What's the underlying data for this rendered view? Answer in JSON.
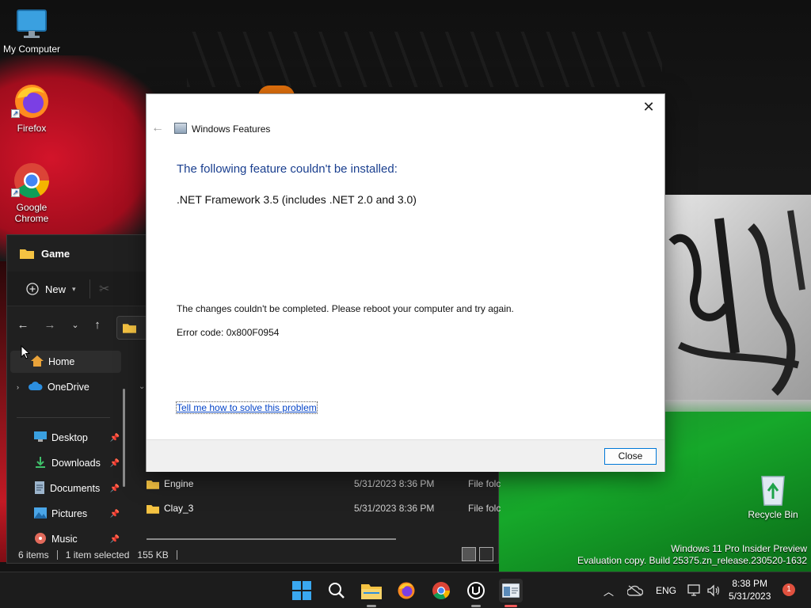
{
  "desktop": {
    "icons": [
      {
        "label": "My Computer"
      },
      {
        "label": "Firefox"
      },
      {
        "label": "Google Chrome"
      }
    ],
    "recycle_bin": "Recycle Bin",
    "watermark": {
      "line1": "Windows 11 Pro Insider Preview",
      "line2": "Evaluation copy. Build 25375.zn_release.230520-1632"
    }
  },
  "explorer": {
    "title": "Game",
    "toolbar": {
      "new_label": "New"
    },
    "sidebar": [
      {
        "label": "Home",
        "icon": "home-icon"
      },
      {
        "label": "OneDrive",
        "icon": "cloud-icon"
      },
      {
        "label": "Desktop",
        "icon": "desktop-icon"
      },
      {
        "label": "Downloads",
        "icon": "download-icon"
      },
      {
        "label": "Documents",
        "icon": "document-icon"
      },
      {
        "label": "Pictures",
        "icon": "picture-icon"
      },
      {
        "label": "Music",
        "icon": "music-icon"
      }
    ],
    "files": [
      {
        "name": "Engine",
        "date": "5/31/2023 8:36 PM",
        "type": "File folc"
      },
      {
        "name": "Clay_3",
        "date": "5/31/2023 8:36 PM",
        "type": "File folc"
      }
    ],
    "status": {
      "items": "6 items",
      "selected": "1 item selected",
      "size": "155 KB"
    }
  },
  "dialog": {
    "window_title": "Windows Features",
    "heading": "The following feature couldn't be installed:",
    "feature": ".NET Framework 3.5 (includes .NET 2.0 and 3.0)",
    "message": "The changes couldn't be completed. Please reboot your computer and try again.",
    "error_code": "Error code: 0x800F0954",
    "link": "Tell me how to solve this problem",
    "close_button": "Close"
  },
  "taskbar": {
    "language": "ENG",
    "time": "8:38 PM",
    "date": "5/31/2023",
    "notification_count": "1"
  },
  "colors": {
    "accent": "#0078d7",
    "heading": "#1a3f8f",
    "link": "#0645c8"
  }
}
